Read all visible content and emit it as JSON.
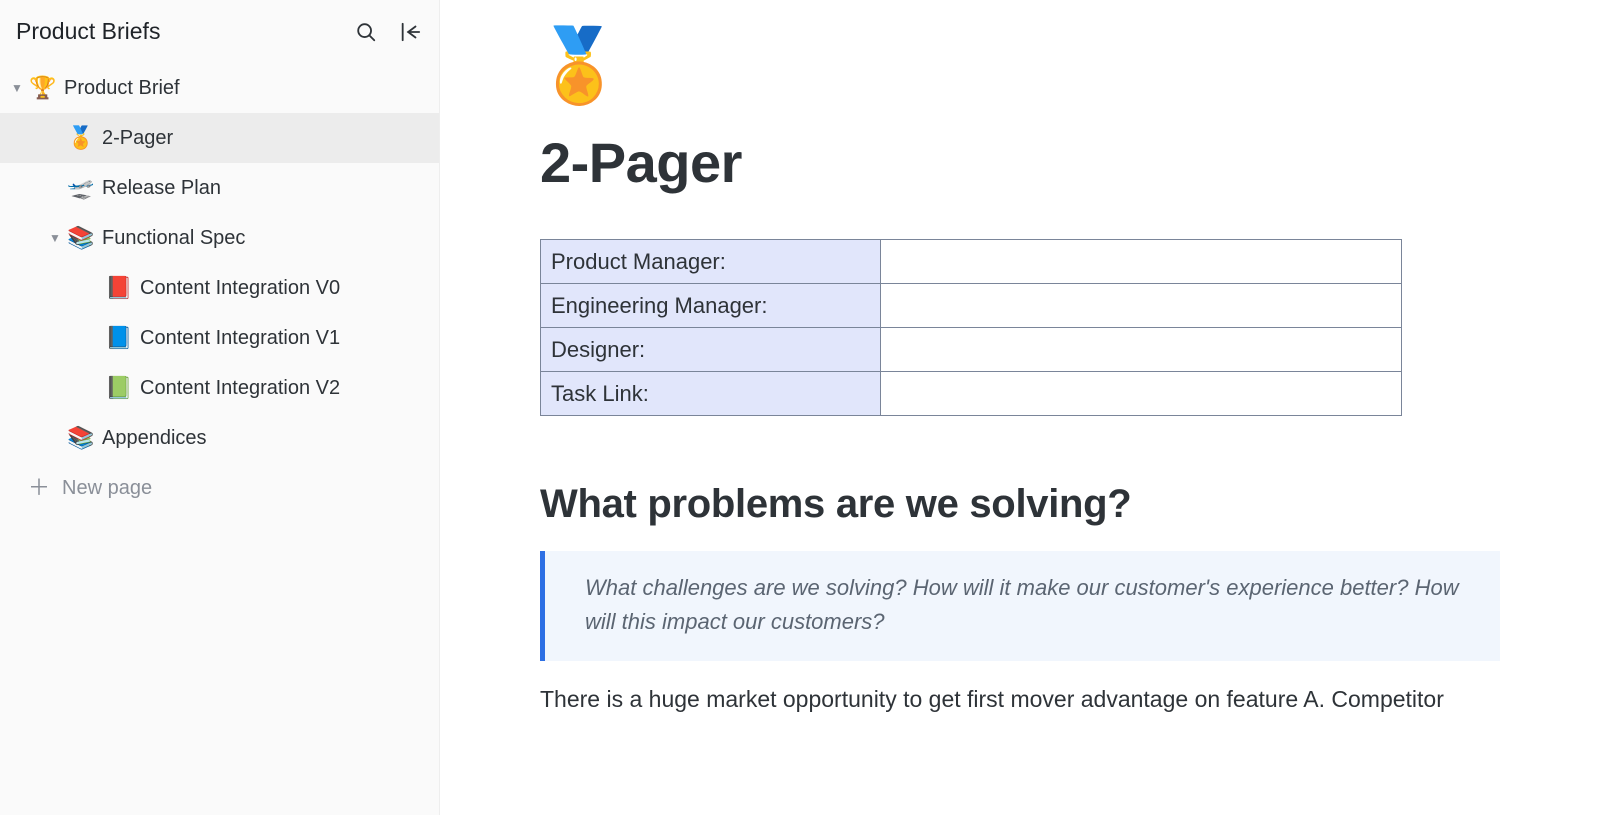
{
  "sidebar": {
    "title": "Product Briefs",
    "new_page": "New page",
    "items": [
      {
        "icon": "🏆",
        "label": "Product Brief",
        "indent": 0,
        "expanded": true,
        "has_children": true
      },
      {
        "icon": "🏅",
        "label": "2-Pager",
        "indent": 1,
        "selected": true
      },
      {
        "icon": "🛫",
        "label": "Release Plan",
        "indent": 1
      },
      {
        "icon": "📚",
        "label": "Functional Spec",
        "indent": 1,
        "expanded": true,
        "has_children": true
      },
      {
        "icon": "📕",
        "label": "Content Integration V0",
        "indent": 3
      },
      {
        "icon": "📘",
        "label": "Content Integration V1",
        "indent": 3
      },
      {
        "icon": "📗",
        "label": "Content Integration V2",
        "indent": 3
      },
      {
        "icon": "📚",
        "label": "Appendices",
        "indent": 1
      }
    ]
  },
  "page": {
    "icon": "🏅",
    "title": "2-Pager",
    "meta_rows": [
      {
        "key": "Product Manager:",
        "val": ""
      },
      {
        "key": "Engineering Manager:",
        "val": ""
      },
      {
        "key": "Designer:",
        "val": ""
      },
      {
        "key": "Task Link:",
        "val": ""
      }
    ],
    "section_heading": "What problems are we solving?",
    "callout": "What challenges are we solving? How will it make our customer's experience better? How will this impact our customers?",
    "body": "There is a huge market opportunity to get first mover advantage on feature A. Competitor"
  }
}
